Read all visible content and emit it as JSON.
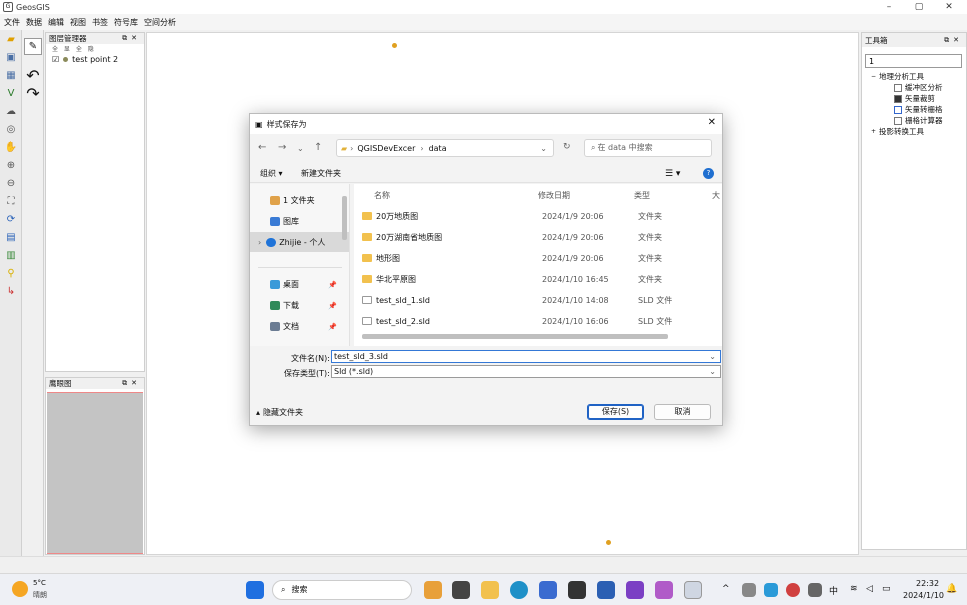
{
  "window": {
    "title": "GeosGIS"
  },
  "menu": [
    "文件",
    "数据",
    "编辑",
    "视图",
    "书签",
    "符号库",
    "空间分析"
  ],
  "layer_panel": {
    "title": "图层管理器",
    "toolbar": "全 显 全 隐",
    "layer_name": "test point 2"
  },
  "eagle_panel": {
    "title": "鹰眼图"
  },
  "toolbox": {
    "title": "工具箱",
    "search_value": "1",
    "items": [
      "地理分析工具",
      "缓冲区分析",
      "矢量裁剪",
      "矢量转栅格",
      "栅格计算器",
      "投影转换工具"
    ]
  },
  "dialog": {
    "title": "样式保存为",
    "path": [
      "QGISDevExcer",
      "data"
    ],
    "search_placeholder": "在 data 中搜索",
    "organize": "组织 ▾",
    "new_folder": "新建文件夹",
    "nav": [
      "1 文件夹",
      "图库",
      "Zhijie - 个人",
      "桌面",
      "下载",
      "文档"
    ],
    "columns": {
      "name": "名称",
      "date": "修改日期",
      "type": "类型",
      "size": "大"
    },
    "files": [
      {
        "name": "20万地质图",
        "date": "2024/1/9 20:06",
        "type": "文件夹",
        "kind": "folder"
      },
      {
        "name": "20万湖南省地质图",
        "date": "2024/1/9 20:06",
        "type": "文件夹",
        "kind": "folder"
      },
      {
        "name": "地形图",
        "date": "2024/1/9 20:06",
        "type": "文件夹",
        "kind": "folder"
      },
      {
        "name": "华北平原图",
        "date": "2024/1/10 16:45",
        "type": "文件夹",
        "kind": "folder"
      },
      {
        "name": "test_sld_1.sld",
        "date": "2024/1/10 14:08",
        "type": "SLD 文件",
        "kind": "file"
      },
      {
        "name": "test_sld_2.sld",
        "date": "2024/1/10 16:06",
        "type": "SLD 文件",
        "kind": "file"
      }
    ],
    "filename_label": "文件名(N):",
    "filename_value": "test_sld_3.sld",
    "filetype_label": "保存类型(T):",
    "filetype_value": "Sld (*.sld)",
    "hide_folders": "隐藏文件夹",
    "save": "保存(S)",
    "cancel": "取消"
  },
  "taskbar": {
    "weather_temp": "5°C",
    "weather_text": "晴朗",
    "search": "搜索",
    "ime": "中",
    "time": "22:32",
    "date": "2024/1/10"
  }
}
